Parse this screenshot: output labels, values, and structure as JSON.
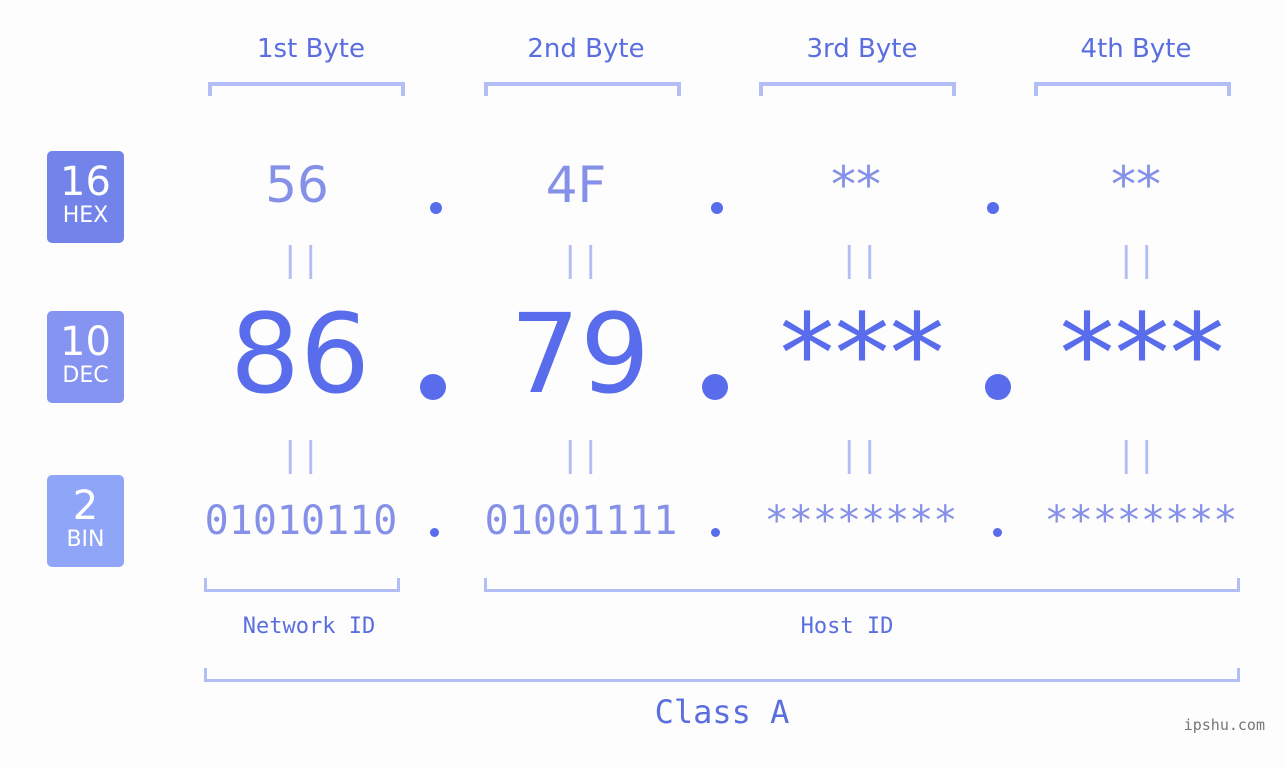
{
  "colors": {
    "accent": "#586cec",
    "hex_badge": "#7283ea",
    "dec_badge": "#8594f0",
    "bin_badge": "#8fa6f8",
    "bracket": "#b3bdf6"
  },
  "bases": [
    {
      "num": "16",
      "label": "HEX"
    },
    {
      "num": "10",
      "label": "DEC"
    },
    {
      "num": "2",
      "label": "BIN"
    }
  ],
  "bytes": [
    {
      "label": "1st Byte",
      "hex": "56",
      "dec": "86",
      "bin": "01010110"
    },
    {
      "label": "2nd Byte",
      "hex": "4F",
      "dec": "79",
      "bin": "01001111"
    },
    {
      "label": "3rd Byte",
      "hex": "**",
      "dec": "***",
      "bin": "********"
    },
    {
      "label": "4th Byte",
      "hex": "**",
      "dec": "***",
      "bin": "********"
    }
  ],
  "equals_glyph": "||",
  "network_label": "Network ID",
  "host_label": "Host ID",
  "class_label": "Class A",
  "watermark": "ipshu.com"
}
